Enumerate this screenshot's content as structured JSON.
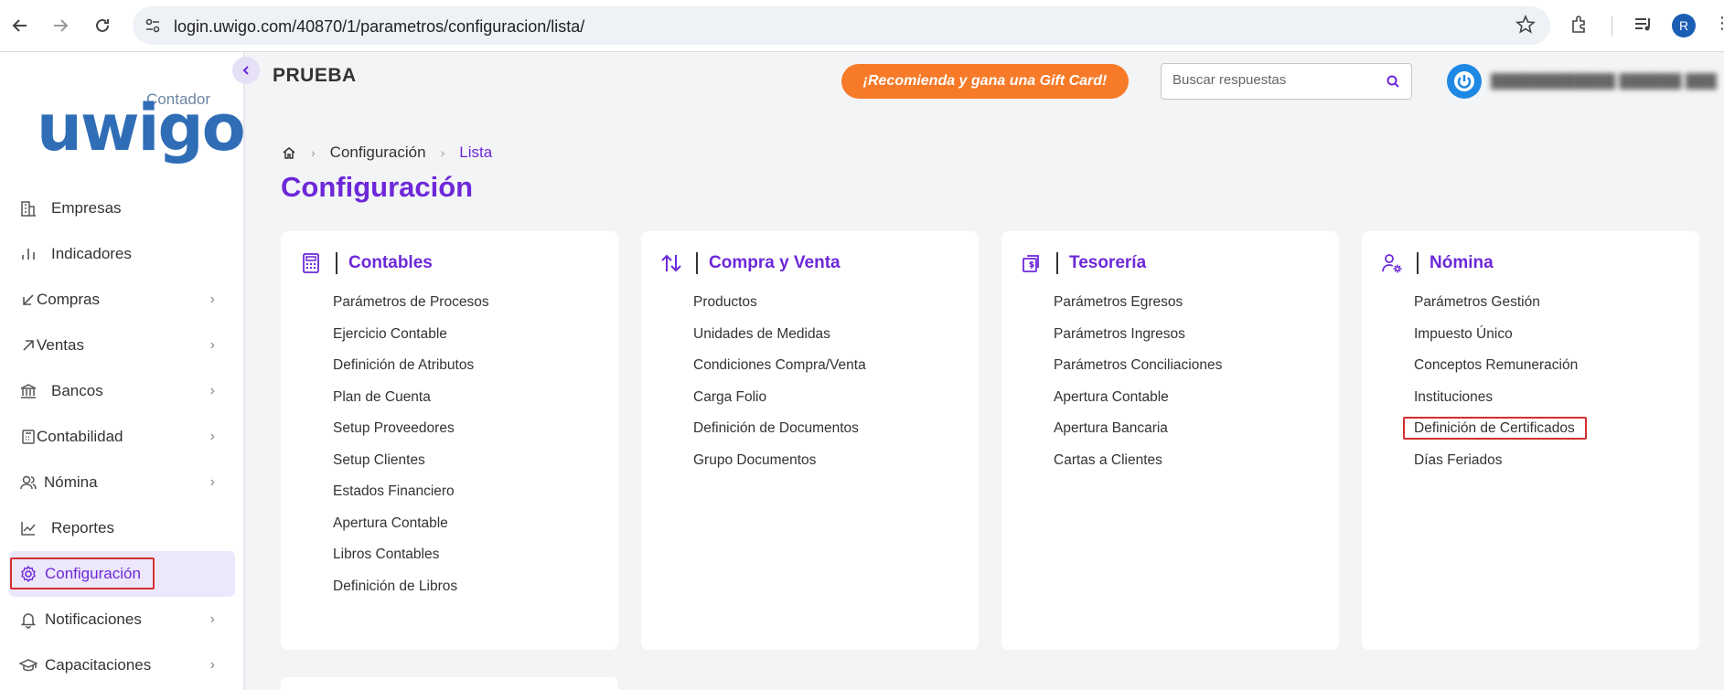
{
  "browser": {
    "url": "login.uwigo.com/40870/1/parametros/configuracion/lista/",
    "avatar_letter": "R"
  },
  "sidebar": {
    "logo_sub": "Contador",
    "logo_main": "uwigo",
    "items": [
      {
        "label": "Empresas",
        "icon": "building-icon",
        "chevron": false
      },
      {
        "label": "Indicadores",
        "icon": "bar-chart-icon",
        "chevron": false
      },
      {
        "label": "Compras",
        "icon": "arrow-down-left-icon",
        "chevron": true
      },
      {
        "label": "Ventas",
        "icon": "arrow-up-right-icon",
        "chevron": true
      },
      {
        "label": "Bancos",
        "icon": "bank-icon",
        "chevron": true
      },
      {
        "label": "Contabilidad",
        "icon": "calculator-icon",
        "chevron": true
      },
      {
        "label": "Nómina",
        "icon": "users-icon",
        "chevron": true
      },
      {
        "label": "Reportes",
        "icon": "line-chart-icon",
        "chevron": false
      },
      {
        "label": "Configuración",
        "icon": "gear-icon",
        "chevron": false,
        "active": true
      },
      {
        "label": "Notificaciones",
        "icon": "bell-icon",
        "chevron": true
      },
      {
        "label": "Capacitaciones",
        "icon": "graduation-cap-icon",
        "chevron": true
      }
    ]
  },
  "header": {
    "company": "PRUEBA",
    "promo": "¡Recomienda y gana una Gift Card!",
    "search_placeholder": "Buscar respuestas"
  },
  "breadcrumb": {
    "level1": "Configuración",
    "level2": "Lista"
  },
  "page_title": "Configuración",
  "cards": [
    {
      "title": "Contables",
      "icon": "calculator-icon",
      "items": [
        "Parámetros de Procesos",
        "Ejercicio Contable",
        "Definición de Atributos",
        "Plan de Cuenta",
        "Setup Proveedores",
        "Setup Clientes",
        "Estados Financiero",
        "Apertura Contable",
        "Libros Contables",
        "Definición de Libros"
      ]
    },
    {
      "title": "Compra y Venta",
      "icon": "swap-vertical-icon",
      "items": [
        "Productos",
        "Unidades de Medidas",
        "Condiciones Compra/Venta",
        "Carga Folio",
        "Definición de Documentos",
        "Grupo Documentos"
      ]
    },
    {
      "title": "Tesorería",
      "icon": "cash-stack-icon",
      "items": [
        "Parámetros Egresos",
        "Parámetros Ingresos",
        "Parámetros Conciliaciones",
        "Apertura Contable",
        "Apertura Bancaria",
        "Cartas a Clientes"
      ]
    },
    {
      "title": "Nómina",
      "icon": "user-gear-icon",
      "items": [
        "Parámetros Gestión",
        "Impuesto Único",
        "Conceptos Remuneración",
        "Instituciones",
        "Definición de Certificados",
        "Días Feriados"
      ]
    }
  ],
  "colors": {
    "accent": "#6d28d9",
    "promo": "#f67a28",
    "highlight": "#d32f2f"
  }
}
